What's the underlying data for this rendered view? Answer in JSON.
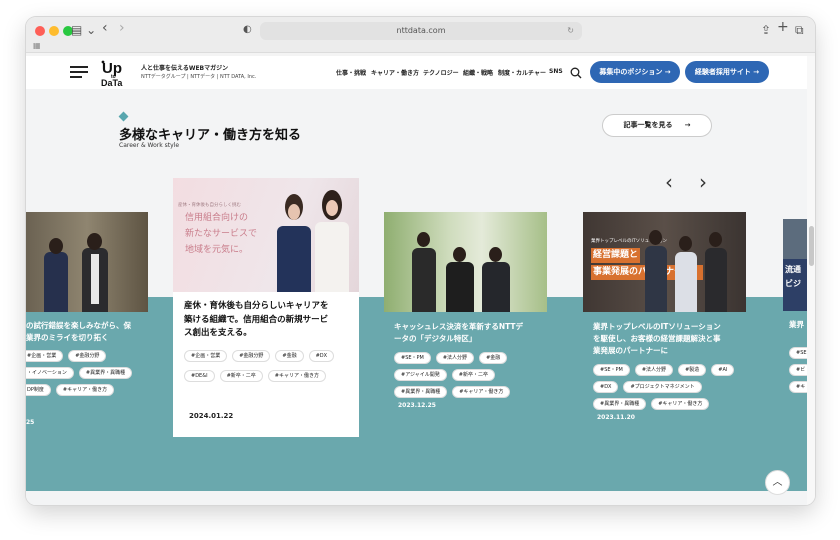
{
  "browser": {
    "url": "nttdata.com"
  },
  "header": {
    "logo_text": "Up to DATA",
    "tagline": "人と仕事を伝えるWEBマガジン",
    "company": "NTTデータグループ | NTTデータ | NTT DATA, Inc.",
    "nav": [
      "仕事・挑戦",
      "キャリア・働き方",
      "テクノロジー",
      "組織・戦略",
      "制度・カルチャー",
      "SNS"
    ],
    "cta_positions": "募集中のポジション →",
    "cta_career": "経験者採用サイト →"
  },
  "section": {
    "title": "多様なキャリア・働き方を知る",
    "subtitle": "Career & Work style",
    "list_button": "記事一覧を見る",
    "list_arrow": "→"
  },
  "cards": [
    {
      "title_lines": [
        "の試行錯誤を楽しみながら、保",
        "業界のミライを切り拓く"
      ],
      "tags": [
        "#企画・営業",
        "#金融分野",
        "・イノベーション",
        "#異業界・異職種",
        "DP制度",
        "#キャリア・働き方"
      ],
      "date": "25"
    },
    {
      "image_text": [
        "信用組合向けの",
        "新たなサービスで",
        "地域を元気に。"
      ],
      "image_banner": "産休・育休後も自分らしく挑む",
      "title_lines": [
        "産休・育休後も自分らしいキャリアを",
        "築ける組織で。信用組合の新規サービ",
        "ス創出を支える。"
      ],
      "tags": [
        "#企画・営業",
        "#金融分野",
        "#金融",
        "#DX",
        "#DE&I",
        "#新卒・二卒",
        "#キャリア・働き方"
      ],
      "date": "2024.01.22"
    },
    {
      "title_lines": [
        "キャッシュレス決済を革新するNTTデ",
        "ータの「デジタル特区」"
      ],
      "tags": [
        "#SE・PM",
        "#法人分野",
        "#金融",
        "#アジャイル開発",
        "#新卒・二卒",
        "#異業界・異職種",
        "#キャリア・働き方"
      ],
      "date": "2023.12.25"
    },
    {
      "image_text": [
        "経営課題と",
        "事業発展のパートナーに。"
      ],
      "image_banner": "業界トップレベルのITソリューション",
      "title_lines": [
        "業界トップレベルのITソリューション",
        "を駆使し、お客様の経営課題解決と事",
        "業発展のパートナーに"
      ],
      "tags": [
        "#SE・PM",
        "#法人分野",
        "#製造",
        "#AI",
        "#DX",
        "#プロジェクトマネジメント",
        "#異業界・異職種",
        "#キャリア・働き方"
      ],
      "date": "2023.11.20"
    },
    {
      "image_text": [
        "流通",
        "ビジ"
      ],
      "title_lines": [
        "業界"
      ],
      "tags": [
        "#SE",
        "#ビ",
        "#キ"
      ],
      "date": ""
    }
  ],
  "colors": {
    "accent": "#2e67b4",
    "band": "#6aa8ad",
    "diamond": "#58a6ae"
  }
}
